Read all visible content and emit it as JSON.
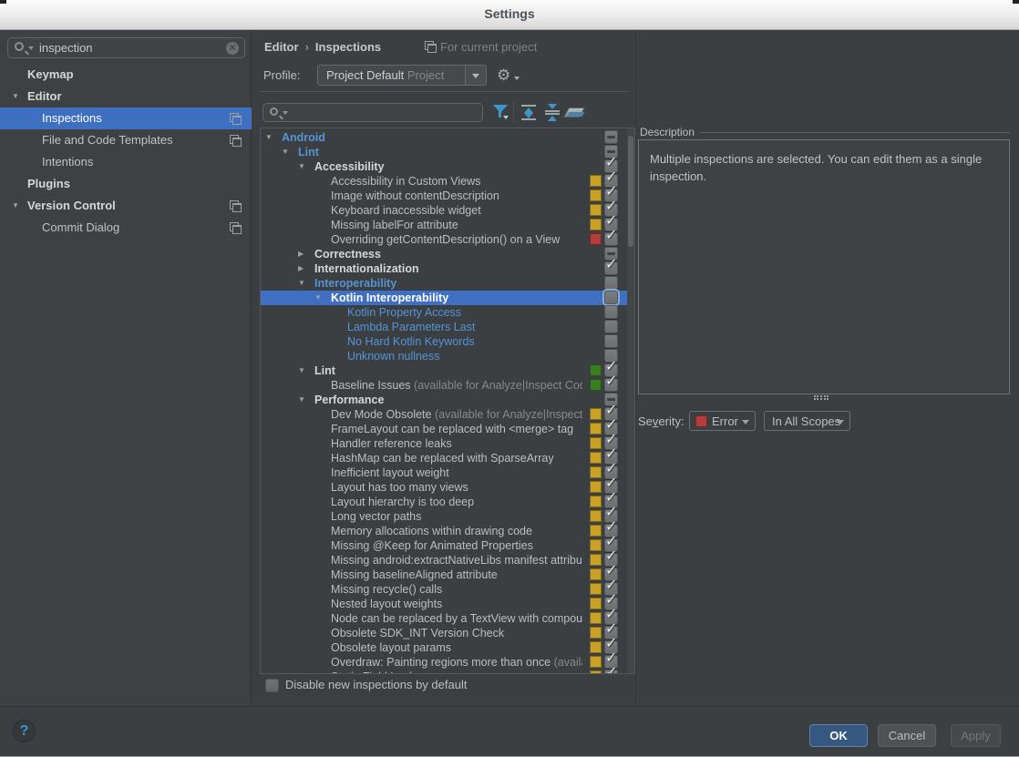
{
  "window": {
    "title": "Settings"
  },
  "colors": {
    "selection_blue": "#3e6fc1",
    "modified_blue_text": "#5394d6",
    "chip_yellow": "#c7a227",
    "chip_red": "#b13d3d",
    "chip_green": "#3a7d22",
    "error_red": "#b13d3d"
  },
  "sidebar": {
    "search": {
      "value": "inspection",
      "clear_icon": "x-circle"
    },
    "items": [
      {
        "label": "Keymap",
        "bold": true,
        "indent": 0,
        "arrow": null,
        "badge": false,
        "selected": false
      },
      {
        "label": "Editor",
        "bold": true,
        "indent": 0,
        "arrow": "open",
        "badge": false,
        "selected": false
      },
      {
        "label": "Inspections",
        "bold": false,
        "indent": 1,
        "arrow": null,
        "badge": true,
        "selected": true
      },
      {
        "label": "File and Code Templates",
        "bold": false,
        "indent": 1,
        "arrow": null,
        "badge": true,
        "selected": false
      },
      {
        "label": "Intentions",
        "bold": false,
        "indent": 1,
        "arrow": null,
        "badge": false,
        "selected": false
      },
      {
        "label": "Plugins",
        "bold": true,
        "indent": 0,
        "arrow": null,
        "badge": false,
        "selected": false
      },
      {
        "label": "Version Control",
        "bold": true,
        "indent": 0,
        "arrow": "open",
        "badge": true,
        "selected": false
      },
      {
        "label": "Commit Dialog",
        "bold": false,
        "indent": 1,
        "arrow": null,
        "badge": true,
        "selected": false
      }
    ]
  },
  "header": {
    "breadcrumb_1": "Editor",
    "breadcrumb_sep": "›",
    "breadcrumb_2": "Inspections",
    "scope_note": "For current project"
  },
  "profile": {
    "label": "Profile:",
    "value": "Project Default",
    "value_suffix": "Project"
  },
  "toolbar": {
    "search_value": "",
    "icons": [
      "filter-funnel",
      "expand-all",
      "collapse-all",
      "reset-eraser"
    ]
  },
  "tree": {
    "rows": [
      {
        "label": "Android",
        "indent": 0,
        "arrow": "open",
        "style": "gblue",
        "chip": null,
        "check": "dash"
      },
      {
        "label": "Lint",
        "indent": 1,
        "arrow": "open",
        "style": "gblue",
        "chip": null,
        "check": "dash"
      },
      {
        "label": "Accessibility",
        "indent": 2,
        "arrow": "open",
        "style": "gwhite",
        "chip": null,
        "check": "checked"
      },
      {
        "label": "Accessibility in Custom Views",
        "indent": 3,
        "arrow": null,
        "style": "item",
        "chip": "yellow",
        "check": "checked"
      },
      {
        "label": "Image without contentDescription",
        "indent": 3,
        "arrow": null,
        "style": "item",
        "chip": "yellow",
        "check": "checked"
      },
      {
        "label": "Keyboard inaccessible widget",
        "indent": 3,
        "arrow": null,
        "style": "item",
        "chip": "yellow",
        "check": "checked"
      },
      {
        "label": "Missing labelFor attribute",
        "indent": 3,
        "arrow": null,
        "style": "item",
        "chip": "yellow",
        "check": "checked"
      },
      {
        "label": "Overriding getContentDescription() on a View",
        "indent": 3,
        "arrow": null,
        "style": "item",
        "chip": "red",
        "check": "checked"
      },
      {
        "label": "Correctness",
        "indent": 2,
        "arrow": "closed",
        "style": "gwhite",
        "chip": null,
        "check": "dash"
      },
      {
        "label": "Internationalization",
        "indent": 2,
        "arrow": "closed",
        "style": "gwhite",
        "chip": null,
        "check": "checked"
      },
      {
        "label": "Interoperability",
        "indent": 2,
        "arrow": "open",
        "style": "gblue",
        "chip": null,
        "check": "empty"
      },
      {
        "label": "Kotlin Interoperability",
        "indent": 3,
        "arrow": "open",
        "style": "gwhite",
        "chip": null,
        "check": "empty",
        "selected": true
      },
      {
        "label": "Kotlin Property Access",
        "indent": 4,
        "arrow": null,
        "style": "iblue",
        "chip": null,
        "check": "empty"
      },
      {
        "label": "Lambda Parameters Last",
        "indent": 4,
        "arrow": null,
        "style": "iblue",
        "chip": null,
        "check": "empty"
      },
      {
        "label": "No Hard Kotlin Keywords",
        "indent": 4,
        "arrow": null,
        "style": "iblue",
        "chip": null,
        "check": "empty"
      },
      {
        "label": "Unknown nullness",
        "indent": 4,
        "arrow": null,
        "style": "iblue",
        "chip": null,
        "check": "empty"
      },
      {
        "label": "Lint",
        "indent": 2,
        "arrow": "open",
        "style": "gwhite",
        "chip": "green",
        "check": "checked"
      },
      {
        "label": "Baseline Issues ",
        "suffix": "(available for Analyze|Inspect Code)",
        "indent": 3,
        "arrow": null,
        "style": "item",
        "chip": "green",
        "check": "checked"
      },
      {
        "label": "Performance",
        "indent": 2,
        "arrow": "open",
        "style": "gwhite",
        "chip": null,
        "check": "dash"
      },
      {
        "label": "Dev Mode Obsolete ",
        "suffix": "(available for Analyze|Inspect Code)",
        "indent": 3,
        "arrow": null,
        "style": "item",
        "chip": "yellow",
        "check": "checked"
      },
      {
        "label": "FrameLayout can be replaced with <merge> tag",
        "indent": 3,
        "arrow": null,
        "style": "item",
        "chip": "yellow",
        "check": "checked"
      },
      {
        "label": "Handler reference leaks",
        "indent": 3,
        "arrow": null,
        "style": "item",
        "chip": "yellow",
        "check": "checked"
      },
      {
        "label": "HashMap can be replaced with SparseArray",
        "indent": 3,
        "arrow": null,
        "style": "item",
        "chip": "yellow",
        "check": "checked"
      },
      {
        "label": "Inefficient layout weight",
        "indent": 3,
        "arrow": null,
        "style": "item",
        "chip": "yellow",
        "check": "checked"
      },
      {
        "label": "Layout has too many views",
        "indent": 3,
        "arrow": null,
        "style": "item",
        "chip": "yellow",
        "check": "checked"
      },
      {
        "label": "Layout hierarchy is too deep",
        "indent": 3,
        "arrow": null,
        "style": "item",
        "chip": "yellow",
        "check": "checked"
      },
      {
        "label": "Long vector paths",
        "indent": 3,
        "arrow": null,
        "style": "item",
        "chip": "yellow",
        "check": "checked"
      },
      {
        "label": "Memory allocations within drawing code",
        "indent": 3,
        "arrow": null,
        "style": "item",
        "chip": "yellow",
        "check": "checked"
      },
      {
        "label": "Missing @Keep for Animated Properties",
        "indent": 3,
        "arrow": null,
        "style": "item",
        "chip": "yellow",
        "check": "checked"
      },
      {
        "label": "Missing android:extractNativeLibs manifest attribute",
        "indent": 3,
        "arrow": null,
        "style": "item",
        "chip": "yellow",
        "check": "checked"
      },
      {
        "label": "Missing baselineAligned attribute",
        "indent": 3,
        "arrow": null,
        "style": "item",
        "chip": "yellow",
        "check": "checked"
      },
      {
        "label": "Missing recycle() calls",
        "indent": 3,
        "arrow": null,
        "style": "item",
        "chip": "yellow",
        "check": "checked"
      },
      {
        "label": "Nested layout weights",
        "indent": 3,
        "arrow": null,
        "style": "item",
        "chip": "yellow",
        "check": "checked"
      },
      {
        "label": "Node can be replaced by a TextView with compound drawables",
        "indent": 3,
        "arrow": null,
        "style": "item",
        "chip": "yellow",
        "check": "checked"
      },
      {
        "label": "Obsolete SDK_INT Version Check",
        "indent": 3,
        "arrow": null,
        "style": "item",
        "chip": "yellow",
        "check": "checked"
      },
      {
        "label": "Obsolete layout params",
        "indent": 3,
        "arrow": null,
        "style": "item",
        "chip": "yellow",
        "check": "checked"
      },
      {
        "label": "Overdraw: Painting regions more than once ",
        "suffix": "(available)",
        "indent": 3,
        "arrow": null,
        "style": "item",
        "chip": "yellow",
        "check": "checked"
      },
      {
        "label": "Static Field Leaks",
        "indent": 3,
        "arrow": null,
        "style": "item",
        "chip": "yellow",
        "check": "checked"
      }
    ]
  },
  "description_panel": {
    "title": "Description",
    "text": "Multiple inspections are selected. You can edit them as a single inspection."
  },
  "severity": {
    "label_pre": "Se",
    "label_mnemonic": "v",
    "label_post": "erity:",
    "value": "Error",
    "scope_value": "In All Scopes"
  },
  "footer": {
    "disable_checkbox_label": "Disable new inspections by default",
    "help": "?",
    "ok": "OK",
    "cancel": "Cancel",
    "apply": "Apply"
  }
}
